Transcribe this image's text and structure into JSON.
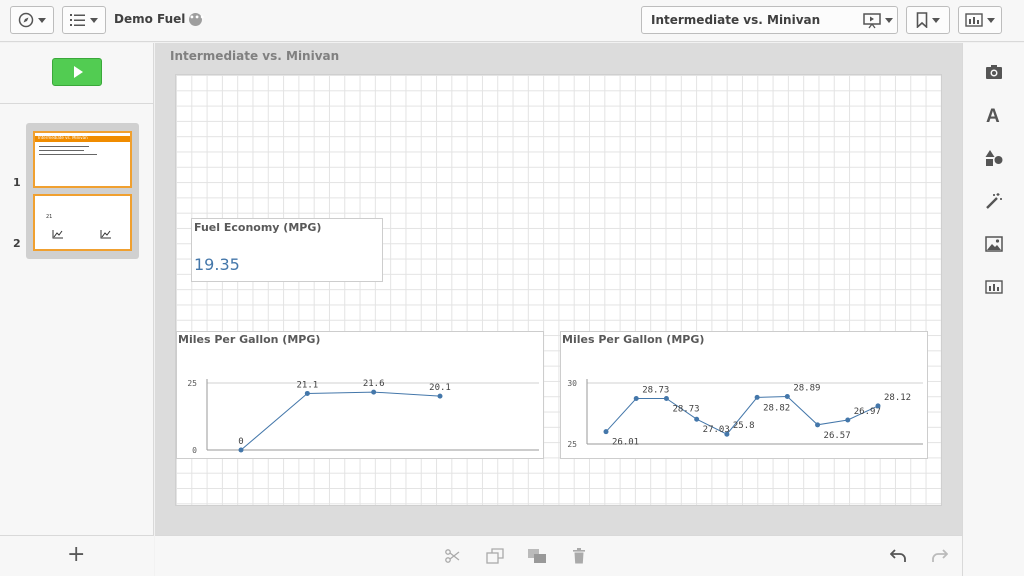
{
  "app": {
    "title": "Demo Fuel",
    "title_badge": "•••",
    "current_sheet": "Intermediate vs. Minivan"
  },
  "toolbar_icons": [
    "compass-icon",
    "list-icon",
    "presentation-icon",
    "bookmark-icon",
    "chart-icon"
  ],
  "slides": [
    {
      "number": "1",
      "thumb_title": "Intermediate vs. Minivan"
    },
    {
      "number": "2",
      "thumb_label": "21"
    }
  ],
  "sheet": {
    "title": "Intermediate vs. Minivan",
    "kpi": {
      "title": "Fuel Economy (MPG)",
      "value": "19.35"
    }
  },
  "chart_data": [
    {
      "type": "line",
      "title": "Miles Per Gallon (MPG)",
      "y_ticks": [
        "25",
        "0"
      ],
      "ylim": [
        0,
        25
      ],
      "values": [
        0,
        21.1,
        21.6,
        20.1
      ],
      "labels": [
        "0",
        "21.1",
        "21.6",
        "20.1"
      ],
      "color": "#4477aa"
    },
    {
      "type": "line",
      "title": "Miles Per Gallon (MPG)",
      "y_ticks": [
        "30",
        "25"
      ],
      "ylim": [
        25,
        30
      ],
      "values": [
        26.01,
        28.73,
        28.73,
        27.03,
        25.8,
        28.82,
        28.89,
        26.57,
        26.97,
        28.12
      ],
      "labels": [
        "26.01",
        "28.73",
        "28.73",
        "27.03",
        "25.8",
        "28.82",
        "28.89",
        "26.57",
        "26.97",
        "28.12"
      ],
      "color": "#4477aa"
    }
  ],
  "colors": {
    "accent": "#52cc52",
    "series": "#4477aa",
    "thumb_border": "#f0a030"
  },
  "bottom_icons": [
    "scissors-icon",
    "copy-icon",
    "duplicate-icon",
    "trash-icon",
    "undo-icon",
    "redo-icon"
  ],
  "right_icons": [
    "camera-icon",
    "text-icon",
    "shapes-icon",
    "magic-wand-icon",
    "image-icon",
    "embed-chart-icon"
  ]
}
